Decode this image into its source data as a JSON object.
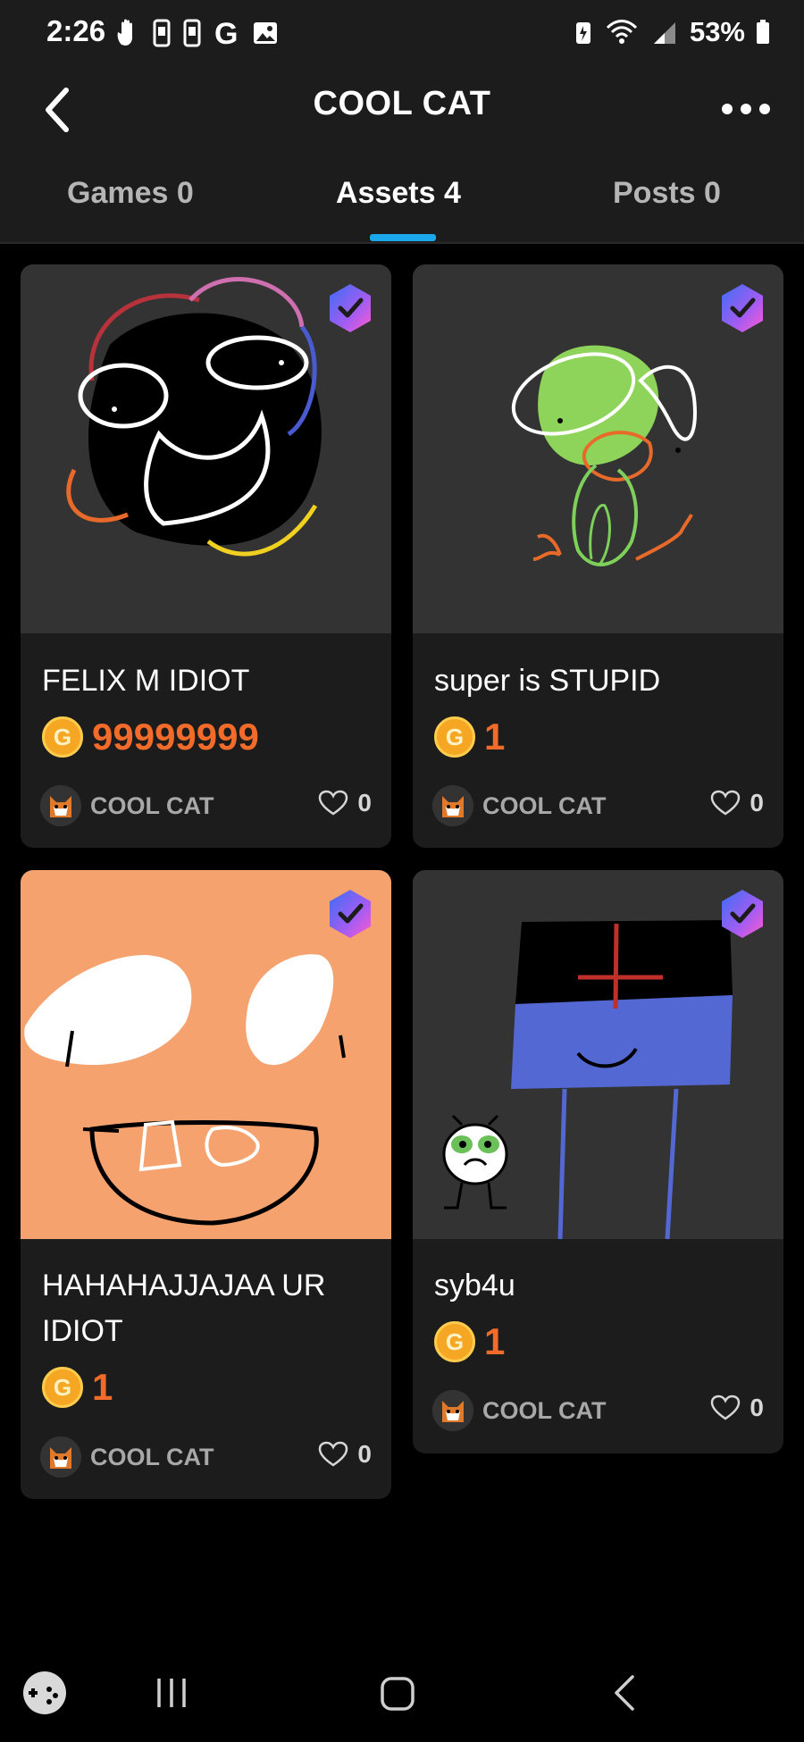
{
  "status": {
    "time": "2:26",
    "battery": "53%"
  },
  "header": {
    "title": "COOL CAT"
  },
  "tabs": [
    {
      "label": "Games 0"
    },
    {
      "label": "Assets 4"
    },
    {
      "label": "Posts 0"
    }
  ],
  "assets": [
    {
      "title": "FELIX M IDIOT",
      "price": "99999999",
      "owner": "COOL CAT",
      "likes": "0"
    },
    {
      "title": "super is STUPID",
      "price": "1",
      "owner": "COOL CAT",
      "likes": "0"
    },
    {
      "title": "HAHAHAJJAJAA UR IDIOT",
      "price": "1",
      "owner": "COOL CAT",
      "likes": "0"
    },
    {
      "title": "syb4u",
      "price": "1",
      "owner": "COOL CAT",
      "likes": "0"
    }
  ],
  "coin_symbol": "G",
  "colors": {
    "accent": "#1aa7ec",
    "price": "#f26b2a",
    "coin": "#f5a623"
  }
}
